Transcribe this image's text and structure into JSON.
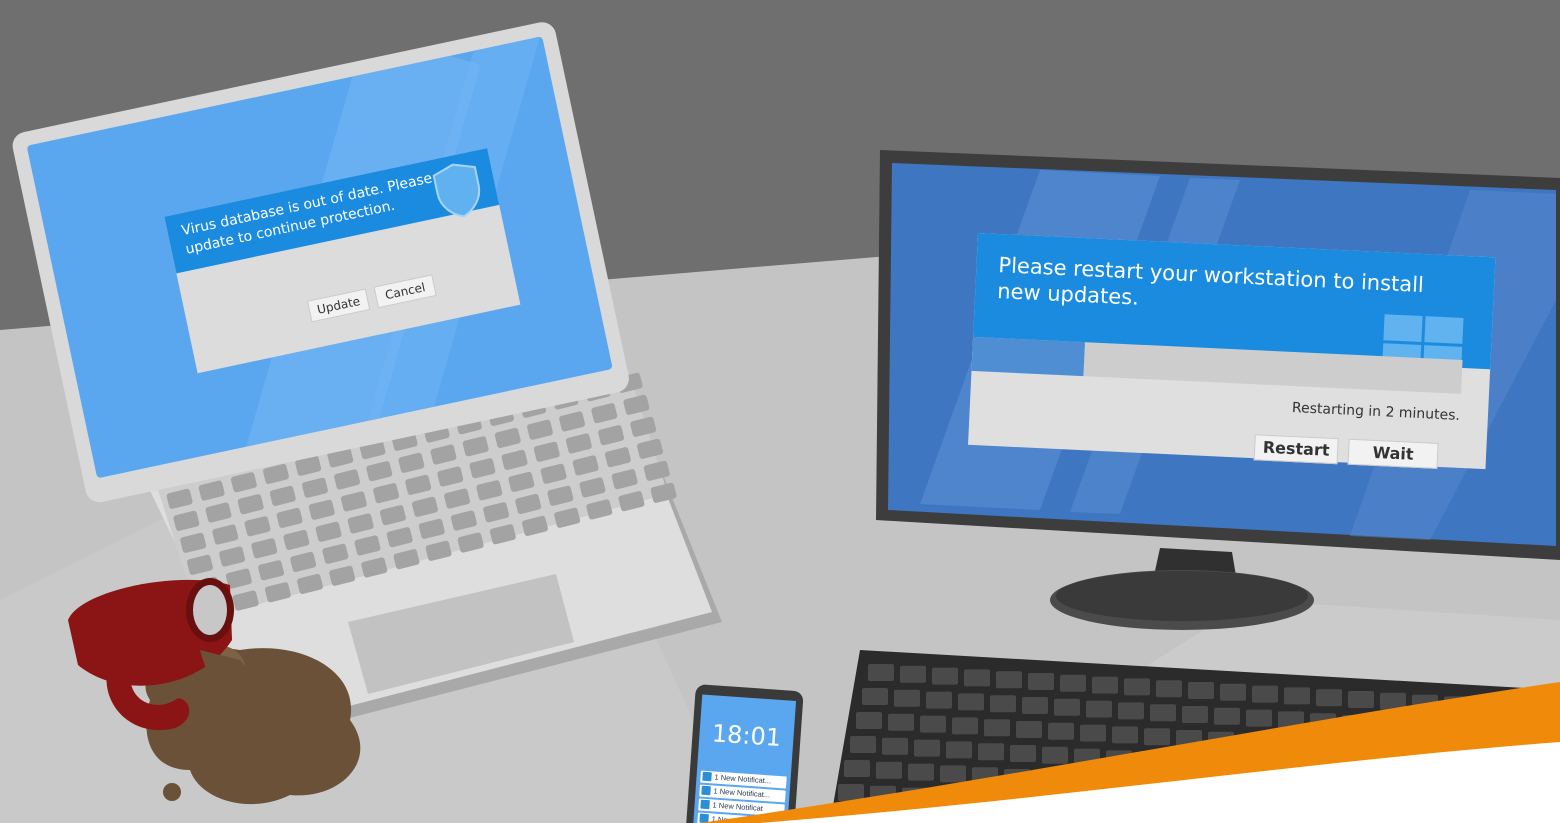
{
  "laptop": {
    "dialog": {
      "message": "Virus database is out of date. Please update to continue protection.",
      "buttons": {
        "update": "Update",
        "cancel": "Cancel"
      },
      "icon": "shield-icon"
    }
  },
  "monitor": {
    "dialog": {
      "message": "Please restart your workstation to install new updates.",
      "status": "Restarting in 2 minutes.",
      "buttons": {
        "restart": "Restart",
        "wait": "Wait"
      },
      "icon": "windows-logo-icon"
    }
  },
  "phone": {
    "time": "18:01",
    "notifications": [
      "1 New Notificat...",
      "1 New Notificat...",
      "1 New Notificat",
      "1 New"
    ],
    "icon": "twitter-bird-icon"
  },
  "colors": {
    "accent": "#f08a0b",
    "screen_blue": "#5aa7f0",
    "dialog_header": "#1b8be0",
    "cup_red": "#b01a1a",
    "coffee": "#6b5137"
  }
}
